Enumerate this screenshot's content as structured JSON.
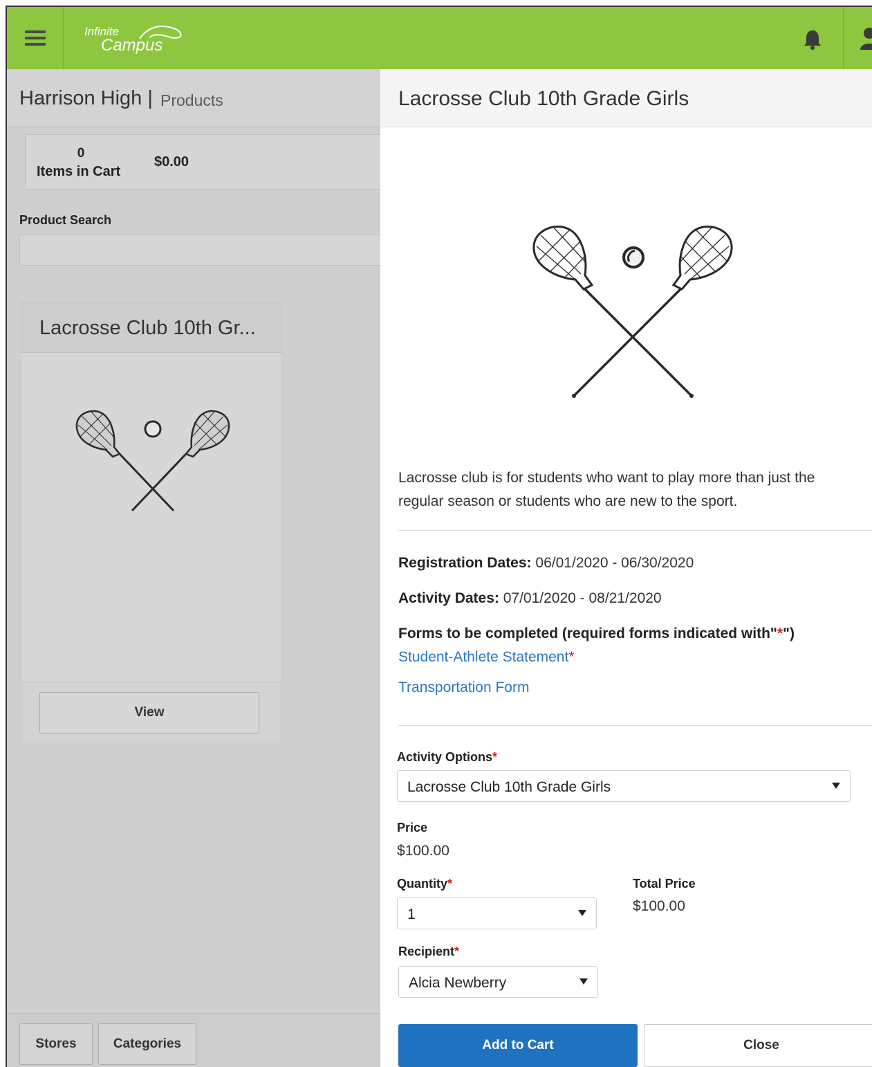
{
  "topbar": {
    "logo_line1": "Infinite",
    "logo_line2": "Campus",
    "brand_color": "#8dc63f",
    "icons": [
      "menu-icon",
      "bell-icon",
      "user-icon"
    ]
  },
  "left": {
    "school": "Harrison High",
    "separator": "|",
    "section": "Products",
    "cart": {
      "count": "0",
      "label": "Items in Cart",
      "total": "$0.00"
    },
    "search": {
      "label": "Product Search",
      "value": ""
    },
    "product_card": {
      "title": "Lacrosse Club 10th Gr...",
      "view_label": "View"
    },
    "footer": {
      "stores": "Stores",
      "categories": "Categories"
    }
  },
  "panel": {
    "title": "Lacrosse Club 10th Grade Girls",
    "description": "Lacrosse club is for students who want to play more than just the regular season or students who are new to the sport.",
    "registration_label": "Registration Dates:",
    "registration_value": "06/01/2020 - 06/30/2020",
    "activity_dates_label": "Activity Dates:",
    "activity_dates_value": "07/01/2020 - 08/21/2020",
    "forms_heading_prefix": "Forms to be completed (required forms indicated with\"",
    "forms_heading_star": "*",
    "forms_heading_suffix": "\")",
    "forms": [
      {
        "label": "Student-Athlete Statement",
        "required": "*"
      },
      {
        "label": "Transportation Form"
      }
    ],
    "activity_options_label": "Activity Options",
    "activity_options_value": "Lacrosse Club 10th Grade Girls",
    "price_label": "Price",
    "price_value": "$100.00",
    "quantity_label": "Quantity",
    "quantity_value": "1",
    "total_label": "Total Price",
    "total_value": "$100.00",
    "recipient_label": "Recipient",
    "recipient_value": "Alcia Newberry",
    "required_mark": "*",
    "add_to_cart": "Add to Cart",
    "close": "Close",
    "accent_color": "#1f72bf",
    "required_color": "#cc2222",
    "link_color": "#2e76c3"
  }
}
